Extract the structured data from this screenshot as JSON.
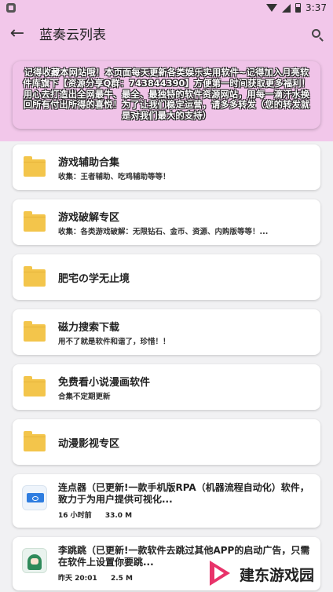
{
  "status_bar": {
    "time": "3:37"
  },
  "app_bar": {
    "title": "蓝奏云列表"
  },
  "notice": {
    "text": "记得收藏本网站哦！本页面每天更新各类娱乐实用软件~记得加入月亮软件库旗下【资源分享Q群：743844390】方便第一时间获取更多福利！ 用心去打造出全网最牛、最全、最独特的软件资源网站，用每一滴汗水换回所有付出所得的喜悦！为了让我们稳定运营，请多多转发（您的转发就是对我们最大的支持）"
  },
  "folders": [
    {
      "title": "游戏辅助合集",
      "subtitle": "收集：王者辅助、吃鸡辅助等等！"
    },
    {
      "title": "游戏破解专区",
      "subtitle": "收集：各类游戏破解：无限钻石、金币、资源、内购版等等！..."
    },
    {
      "title": "肥宅の学无止境",
      "subtitle": ""
    },
    {
      "title": "磁力搜索下载",
      "subtitle": "用不了就是软件和谐了，珍惜！！"
    },
    {
      "title": "免费看小说漫画软件",
      "subtitle": "合集不定期更新"
    },
    {
      "title": "动漫影视专区",
      "subtitle": ""
    }
  ],
  "apps": [
    {
      "icon": "auto-clicker-app-icon",
      "title": "连点器（已更新!一款手机版RPA（机器流程自动化）软件，致力于为用户提供可视化...",
      "time": "16 小时前",
      "size": "33.0 M"
    },
    {
      "icon": "skip-ads-app-icon",
      "title": "李跳跳（已更新!一款软件去跳过其他APP的启动广告，只需在软件上设置你要跳...",
      "time": "昨天 20:01",
      "size": "2.5 M"
    }
  ],
  "watermark": {
    "text": "建东游戏园"
  },
  "colors": {
    "header": "#f2c7ea",
    "folder": "#f3c54b",
    "background": "#f1f1f3"
  }
}
